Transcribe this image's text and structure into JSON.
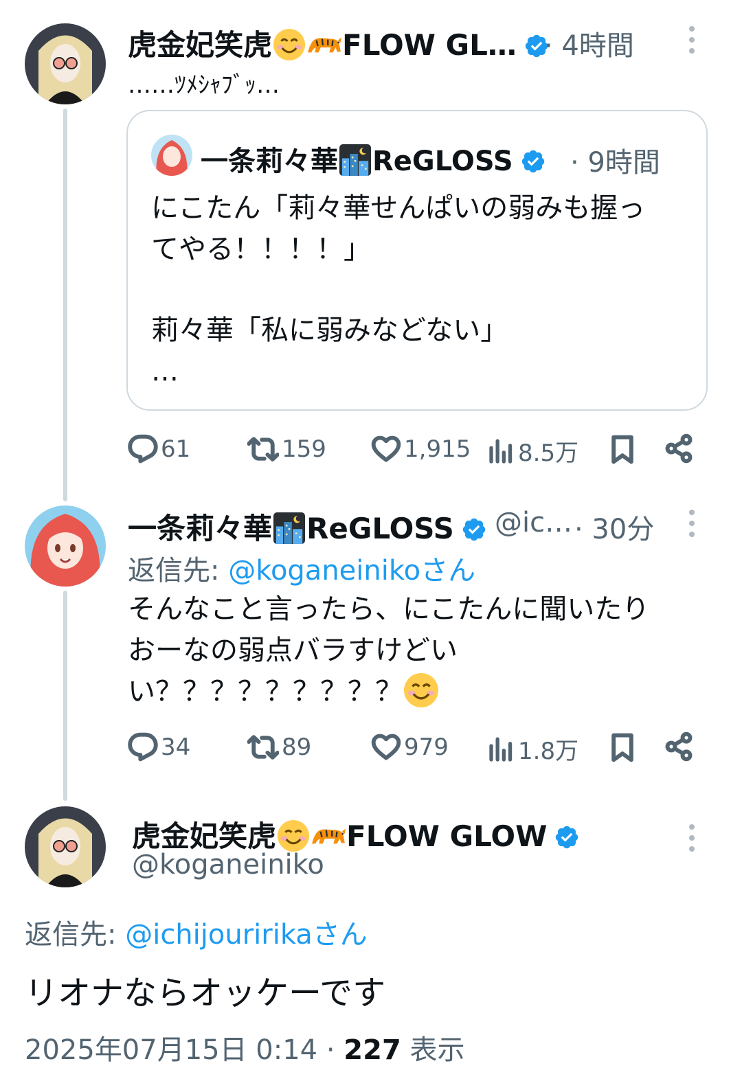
{
  "tweet1": {
    "display_name": "虎金妃笑虎",
    "display_name_suffix": "FLOW GL…",
    "time": "· 4時間",
    "text": "……ﾂﾒｼｬﾌﾞｯ…",
    "quote": {
      "display_name": "一条莉々華",
      "display_name_suffix": "ReGLOSS",
      "time": "· 9時間",
      "line1": "にこたん「莉々華せんぱいの弱みも握っ",
      "line2": "てやる！！！！」",
      "line3": "莉々華「私に弱みなどない」",
      "line4": "…"
    },
    "stats": {
      "replies": "61",
      "retweets": "159",
      "likes": "1,915",
      "views": "8.5万"
    }
  },
  "tweet2": {
    "display_name": "一条莉々華",
    "display_name_suffix": "ReGLOSS",
    "handle": "@ic…",
    "time": "· 30分",
    "reply_prefix": "返信先: ",
    "reply_to": "@koganeinikoさん",
    "line1": "そんなこと言ったら、にこたんに聞いたり",
    "line2": "おーなの弱点バラすけどい",
    "line3": "い？？？？？？？？？",
    "stats": {
      "replies": "34",
      "retweets": "89",
      "likes": "979",
      "views": "1.8万"
    }
  },
  "tweet3": {
    "display_name": "虎金妃笑虎",
    "display_name_suffix": "FLOW GLOW",
    "handle": "@koganeiniko",
    "reply_prefix": "返信先: ",
    "reply_to": "@ichijouririkaさん",
    "text": "リオナならオッケーです",
    "timestamp": "2025年07月15日 0:14 · ",
    "views_count": "227",
    "views_label": " 表示"
  },
  "icons": [
    "more-icon",
    "verified-icon",
    "reply-icon",
    "retweet-icon",
    "like-icon",
    "views-icon",
    "bookmark-icon",
    "share-icon",
    "smile-emoji",
    "tiger-emoji",
    "night-city-emoji"
  ],
  "colors": {
    "link": "#1d9bf0",
    "muted": "#536471",
    "verified": "#1d9bf0",
    "thread_line": "#cfd9de"
  }
}
